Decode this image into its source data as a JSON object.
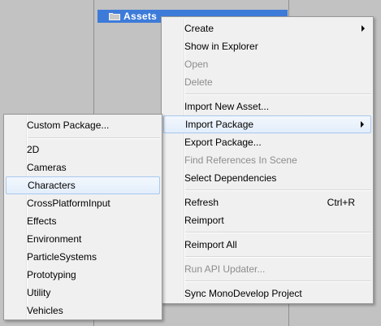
{
  "project": {
    "folder_icon": "folder-icon",
    "assets_label": "Assets"
  },
  "context_menu": {
    "items": [
      {
        "label": "Create",
        "submenu": true
      },
      {
        "label": "Show in Explorer"
      },
      {
        "label": "Open",
        "disabled": true
      },
      {
        "label": "Delete",
        "disabled": true
      },
      {
        "label": "Import New Asset..."
      },
      {
        "label": "Import Package",
        "submenu": true,
        "highlighted": true
      },
      {
        "label": "Export Package..."
      },
      {
        "label": "Find References In Scene",
        "disabled": true
      },
      {
        "label": "Select Dependencies"
      },
      {
        "label": "Refresh",
        "shortcut": "Ctrl+R"
      },
      {
        "label": "Reimport"
      },
      {
        "label": "Reimport All"
      },
      {
        "label": "Run API Updater...",
        "disabled": true
      },
      {
        "label": "Sync MonoDevelop Project"
      }
    ]
  },
  "import_package_menu": {
    "items": [
      {
        "label": "Custom Package..."
      },
      {
        "label": "2D"
      },
      {
        "label": "Cameras"
      },
      {
        "label": "Characters",
        "highlighted": true
      },
      {
        "label": "CrossPlatformInput"
      },
      {
        "label": "Effects"
      },
      {
        "label": "Environment"
      },
      {
        "label": "ParticleSystems"
      },
      {
        "label": "Prototyping"
      },
      {
        "label": "Utility"
      },
      {
        "label": "Vehicles"
      }
    ]
  }
}
